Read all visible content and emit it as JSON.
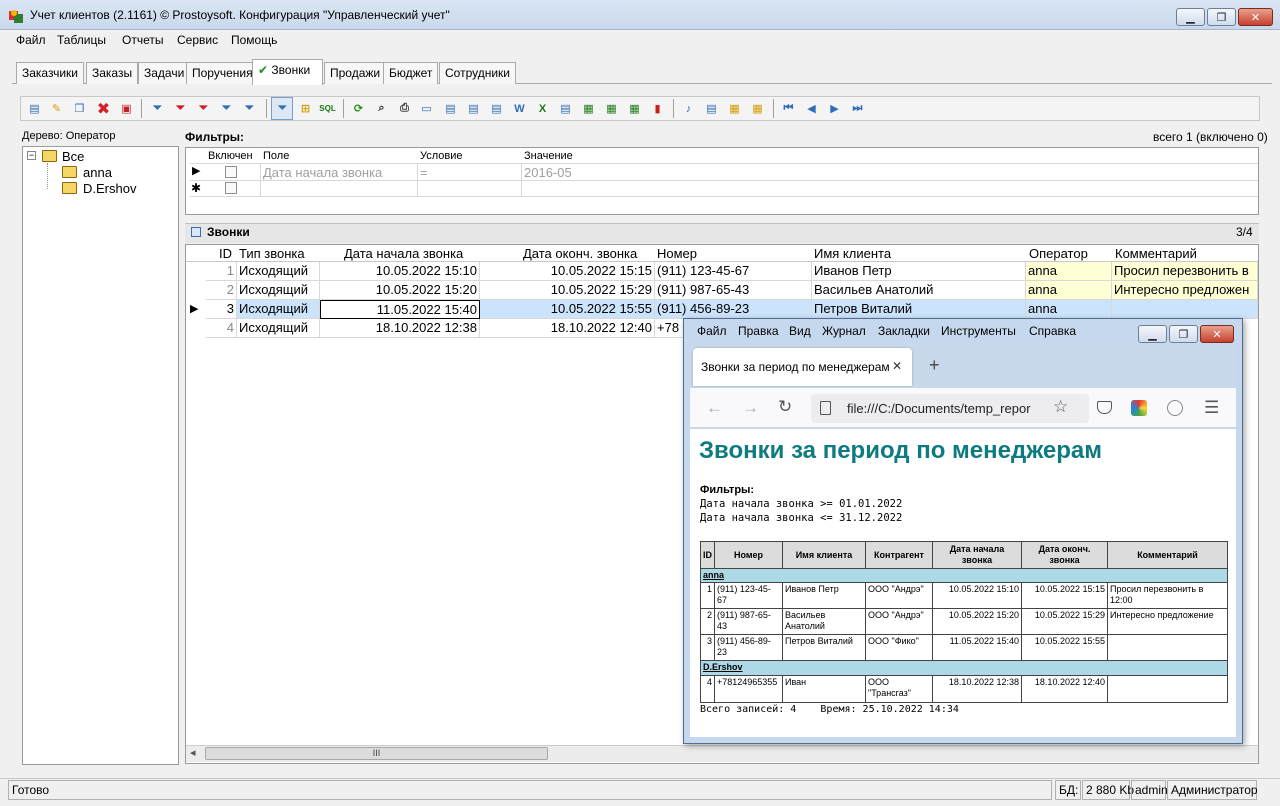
{
  "window": {
    "title": "Учет клиентов (2.1161) © Prostoysoft. Конфигурация \"Управленческий учет\"",
    "minimize": "▁",
    "maximize": "❐",
    "close": "✕"
  },
  "menu": [
    "Файл",
    "Таблицы",
    "Отчеты",
    "Сервис",
    "Помощь"
  ],
  "tabs": [
    "Заказчики",
    "Заказы",
    "Задачи",
    "Поручения",
    "Звонки",
    "Продажи",
    "Бюджет",
    "Сотрудники"
  ],
  "active_tab_check": "✔",
  "tree": {
    "label": "Дерево: Оператор",
    "root": "Все",
    "children": [
      "anna",
      "D.Ershov"
    ],
    "expander": "−"
  },
  "filters": {
    "title": "Фильтры:",
    "total": "всего 1 (включено 0)",
    "columns": [
      "Включен",
      "Поле",
      "Условие",
      "Значение"
    ],
    "row": {
      "field": "Дата начала звонка",
      "condition": "=",
      "value": "2016-05"
    },
    "new_row_marker": "✱",
    "current_marker": "▶"
  },
  "calls": {
    "title": "Звонки",
    "count": "3/4",
    "columns": [
      "ID",
      "Тип звонка",
      "Дата начала звонка",
      "Дата оконч. звонка",
      "Номер",
      "Имя клиента",
      "Оператор",
      "Комментарий"
    ],
    "rows": [
      {
        "id": "1",
        "type": "Исходящий",
        "start": "10.05.2022 15:10",
        "end": "10.05.2022 15:15",
        "phone": "(911) 123-45-67",
        "client": "Иванов Петр",
        "operator": "anna",
        "comment": "Просил перезвонить в"
      },
      {
        "id": "2",
        "type": "Исходящий",
        "start": "10.05.2022 15:20",
        "end": "10.05.2022 15:29",
        "phone": "(911) 987-65-43",
        "client": "Васильев Анатолий",
        "operator": "anna",
        "comment": "Интересно предложен"
      },
      {
        "id": "3",
        "type": "Исходящий",
        "start": "11.05.2022 15:40",
        "end": "10.05.2022 15:55",
        "phone": "(911) 456-89-23",
        "client": "Петров Виталий",
        "operator": "anna",
        "comment": ""
      },
      {
        "id": "4",
        "type": "Исходящий",
        "start": "18.10.2022 12:38",
        "end": "18.10.2022 12:40",
        "phone": "+78",
        "client": "",
        "operator": "",
        "comment": ""
      }
    ],
    "current_marker": "▶",
    "scroll_arrow_left": "◂",
    "scroll_grip": "III"
  },
  "statusbar": {
    "status": "Готово",
    "db_label": "БД:",
    "db_size": "2 880 Kb",
    "user": "admin",
    "role": "Администратор"
  },
  "browser": {
    "menu": [
      "Файл",
      "Правка",
      "Вид",
      "Журнал",
      "Закладки",
      "Инструменты",
      "Справка"
    ],
    "tab_title": "Звонки за период по менеджерам",
    "tab_close": "✕",
    "new_tab": "+",
    "url": "file:///C:/Documents/temp_repor",
    "nav": {
      "back": "←",
      "forward": "→",
      "reload": "↻",
      "star": "☆",
      "menu": "☰"
    },
    "report": {
      "heading": "Звонки за период по менеджерам",
      "filters_label": "Фильтры:",
      "filter_lines": [
        "Дата начала звонка >= 01.01.2022",
        "Дата начала звонка <= 31.12.2022"
      ],
      "columns": [
        "ID",
        "Номер",
        "Имя клиента",
        "Контрагент",
        "Дата начала звонка",
        "Дата оконч. звонка",
        "Комментарий"
      ],
      "groups": [
        {
          "name": "anna",
          "rows": [
            {
              "id": "1",
              "phone": "(911) 123-45-67",
              "client": "Иванов Петр",
              "company": "ООО \"Андрэ\"",
              "start": "10.05.2022 15:10",
              "end": "10.05.2022 15:15",
              "comment": "Просил перезвонить в 12:00"
            },
            {
              "id": "2",
              "phone": "(911) 987-65-43",
              "client": "Васильев Анатолий",
              "company": "ООО \"Андрэ\"",
              "start": "10.05.2022 15:20",
              "end": "10.05.2022 15:29",
              "comment": "Интересно предложение"
            },
            {
              "id": "3",
              "phone": "(911) 456-89-23",
              "client": "Петров Виталий",
              "company": "ООО \"Фико\"",
              "start": "11.05.2022 15:40",
              "end": "10.05.2022 15:55",
              "comment": ""
            }
          ]
        },
        {
          "name": "D.Ershov",
          "rows": [
            {
              "id": "4",
              "phone": "+78124965355",
              "client": "Иван",
              "company": "ООО \"Трансгаз\"",
              "start": "18.10.2022 12:38",
              "end": "18.10.2022 12:40",
              "comment": ""
            }
          ]
        }
      ],
      "footer": "Всего записей: 4    Время: 25.10.2022 14:34"
    }
  },
  "colors": {
    "accent_heading": "#0d7b80",
    "selected_row": "#cce4fb",
    "operator_cell": "#ffffd6",
    "group_row": "#add8e6"
  }
}
